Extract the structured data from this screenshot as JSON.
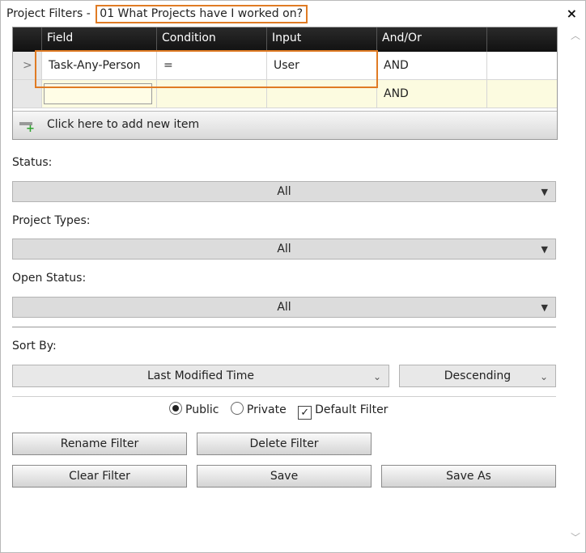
{
  "window": {
    "title_prefix": "Project Filters - ",
    "filter_name": "01 What Projects have I worked on?",
    "close_glyph": "×"
  },
  "grid": {
    "columns": [
      "Field",
      "Condition",
      "Input",
      "And/Or"
    ],
    "rows": [
      {
        "field": "Task-Any-Person",
        "condition": "=",
        "input": "User",
        "andor": "AND"
      },
      {
        "field": "",
        "condition": "",
        "input": "",
        "andor": "AND"
      }
    ],
    "add_item_label": "Click here to add new item"
  },
  "status": {
    "label": "Status:",
    "value": "All"
  },
  "project_types": {
    "label": "Project Types:",
    "value": "All"
  },
  "open_status": {
    "label": "Open Status:",
    "value": "All"
  },
  "sort": {
    "label": "Sort By:",
    "field_value": "Last Modified Time",
    "order_value": "Descending"
  },
  "visibility": {
    "public_label": "Public",
    "private_label": "Private",
    "default_label": "Default Filter",
    "selected": "Public",
    "default_checked": true
  },
  "buttons": {
    "rename": "Rename Filter",
    "delete": "Delete Filter",
    "clear": "Clear Filter",
    "save": "Save",
    "save_as": "Save As"
  },
  "icons": {
    "row_indicator": "chevron-right-icon",
    "add_item": "add-row-icon",
    "close": "close-icon",
    "dropdown": "caret-down-icon"
  },
  "colors": {
    "highlight": "#e07b24",
    "header_bg": "#1a1a1a",
    "new_row_bg": "#fcfbe0"
  }
}
